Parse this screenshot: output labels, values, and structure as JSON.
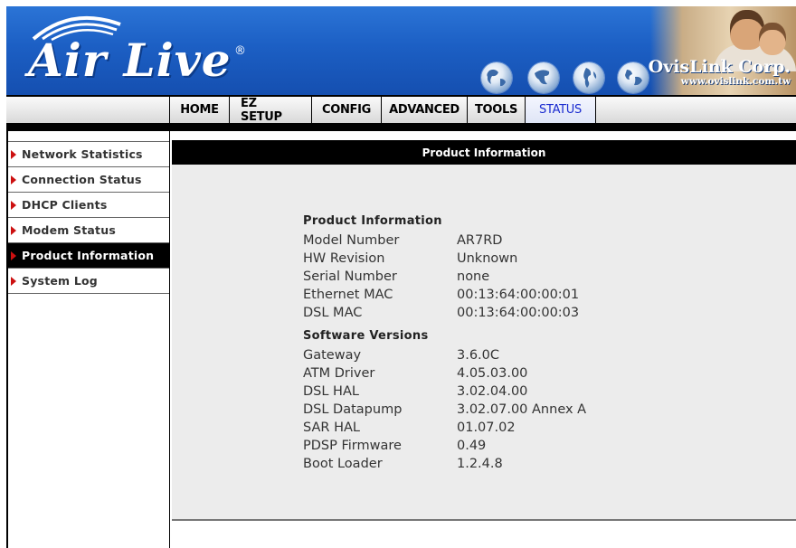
{
  "brand": {
    "logo": "Air Live",
    "reg_mark": "®",
    "partner": "OvisLink Corp.",
    "partner_url": "www.ovislink.com.tw"
  },
  "nav": {
    "tabs": [
      {
        "label": "HOME",
        "active": false
      },
      {
        "label": "EZ SETUP",
        "active": false
      },
      {
        "label": "CONFIG",
        "active": false
      },
      {
        "label": "ADVANCED",
        "active": false
      },
      {
        "label": "TOOLS",
        "active": false
      },
      {
        "label": "STATUS",
        "active": true
      }
    ]
  },
  "sidebar": {
    "items": [
      {
        "label": "Network Statistics",
        "active": false
      },
      {
        "label": "Connection Status",
        "active": false
      },
      {
        "label": "DHCP Clients",
        "active": false
      },
      {
        "label": "Modem Status",
        "active": false
      },
      {
        "label": "Product Information",
        "active": true
      },
      {
        "label": "System Log",
        "active": false
      }
    ]
  },
  "content": {
    "header": "Product Information",
    "product_section_title": "Product Information",
    "product_rows": [
      {
        "key": "Model Number",
        "value": "AR7RD"
      },
      {
        "key": "HW Revision",
        "value": "Unknown"
      },
      {
        "key": "Serial Number",
        "value": "none"
      },
      {
        "key": "Ethernet MAC",
        "value": "00:13:64:00:00:01"
      },
      {
        "key": "DSL MAC",
        "value": "00:13:64:00:00:03"
      }
    ],
    "software_section_title": "Software Versions",
    "software_rows": [
      {
        "key": "Gateway",
        "value": "3.6.0C"
      },
      {
        "key": "ATM Driver",
        "value": "4.05.03.00"
      },
      {
        "key": "DSL HAL",
        "value": "3.02.04.00"
      },
      {
        "key": "DSL Datapump",
        "value": "3.02.07.00 Annex A"
      },
      {
        "key": "SAR HAL",
        "value": "01.07.02"
      },
      {
        "key": "PDSP Firmware",
        "value": "0.49"
      },
      {
        "key": "Boot Loader",
        "value": "1.2.4.8"
      }
    ]
  },
  "colors": {
    "banner_blue": "#1c5fc4",
    "active_tab_text": "#1a2bd0",
    "sidebar_arrow": "#cc1010",
    "content_bg": "#ececec"
  }
}
